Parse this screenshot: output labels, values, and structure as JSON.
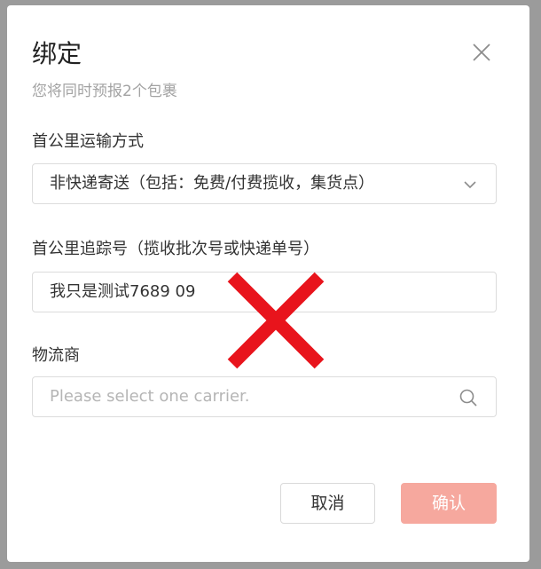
{
  "dialog": {
    "title": "绑定",
    "subtitle": "您将同时预报2个包裹",
    "close_icon": "close-icon"
  },
  "form": {
    "transport": {
      "label": "首公里运输方式",
      "value": "非快递寄送（包括：免费/付费揽收，集货点）",
      "icon": "chevron-down-icon"
    },
    "tracking": {
      "label": "首公里追踪号（揽收批次号或快递单号）",
      "value": "我只是测试7689 09"
    },
    "carrier": {
      "label": "物流商",
      "placeholder": "Please select one carrier.",
      "icon": "search-icon"
    }
  },
  "footer": {
    "cancel_label": "取消",
    "confirm_label": "确认"
  },
  "overlay": {
    "mark": "red-x-mark",
    "color": "#e8141c"
  },
  "colors": {
    "confirm_button": "#f6a89e",
    "text": "#333333",
    "muted": "#a3a3a3"
  }
}
